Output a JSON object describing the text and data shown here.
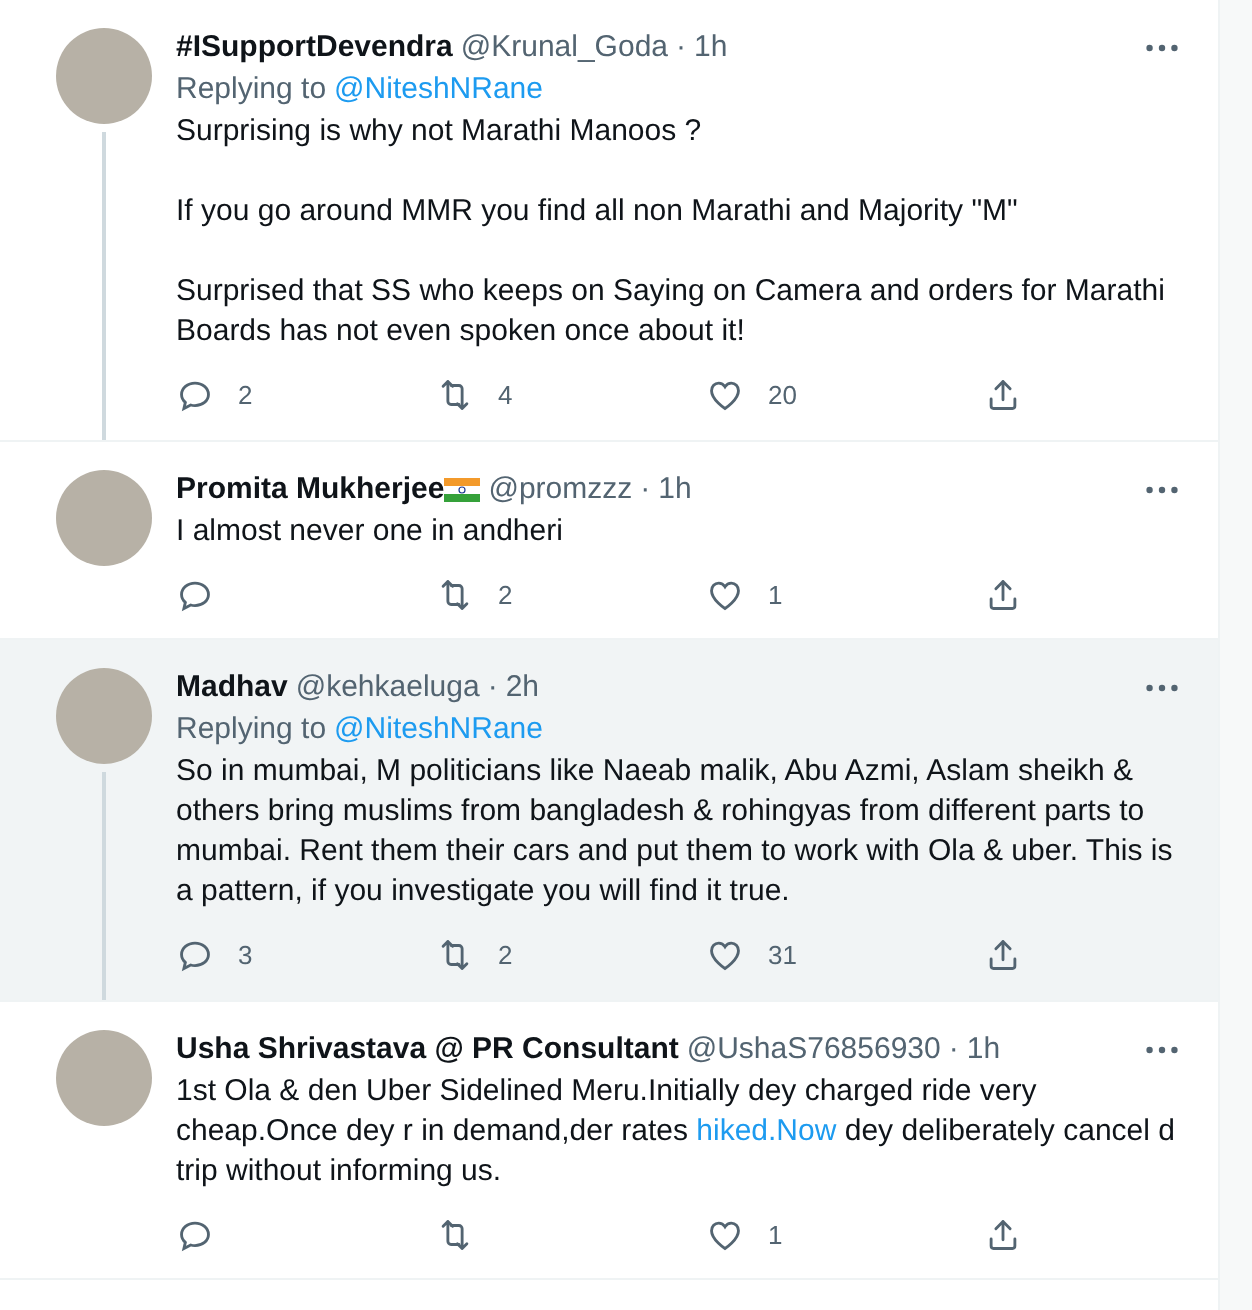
{
  "tweets": [
    {
      "name": "#ISupportDevendra",
      "flag_badge": false,
      "handle": "@Krunal_Goda",
      "separator": "·",
      "time": "1h",
      "highlighted": false,
      "thread_line": true,
      "replying_label": "Replying to",
      "replying_to": "@NiteshNRane",
      "paragraphs": [
        [
          {
            "kind": "plain",
            "text": "Surprising is why not Marathi Manoos ?"
          }
        ],
        [
          {
            "kind": "plain",
            "text": "If you go around MMR you find all non Marathi and Majority \"M\""
          }
        ],
        [
          {
            "kind": "plain",
            "text": "Surprised that SS who keeps on Saying on Camera and orders for Marathi Boards has not even spoken once about it!"
          }
        ]
      ],
      "replies": "2",
      "retweets": "4",
      "likes": "20"
    },
    {
      "name": "Promita Mukherjee",
      "flag_badge": true,
      "handle": "@promzzz",
      "separator": "·",
      "time": "1h",
      "highlighted": false,
      "thread_line": false,
      "paragraphs": [
        [
          {
            "kind": "plain",
            "text": "I almost never one in andheri"
          }
        ]
      ],
      "retweets": "2",
      "likes": "1"
    },
    {
      "name": "Madhav",
      "flag_badge": false,
      "handle": "@kehkaeluga",
      "separator": "·",
      "time": "2h",
      "highlighted": true,
      "thread_line": true,
      "replying_label": "Replying to",
      "replying_to": "@NiteshNRane",
      "paragraphs": [
        [
          {
            "kind": "plain",
            "text": "So in mumbai, M politicians like Naeab malik, Abu Azmi, Aslam sheikh & others bring muslims from bangladesh & rohingyas from different parts to mumbai. Rent them their cars and put them to work with Ola & uber. This is a pattern, if you investigate you will find it true."
          }
        ]
      ],
      "replies": "3",
      "retweets": "2",
      "likes": "31"
    },
    {
      "name": "Usha Shrivastava @ PR Consultant",
      "flag_badge": false,
      "handle": "@UshaS76856930",
      "separator": "·",
      "time": "1h",
      "highlighted": false,
      "thread_line": false,
      "paragraphs": [
        [
          {
            "kind": "plain",
            "text": "1st Ola & den Uber Sidelined Meru.Initially dey charged ride very cheap.Once dey r in demand,der rates "
          },
          {
            "kind": "link",
            "text": "hiked.Now"
          },
          {
            "kind": "plain",
            "text": " dey deliberately cancel d trip without informing us."
          }
        ]
      ],
      "likes": "1"
    }
  ]
}
